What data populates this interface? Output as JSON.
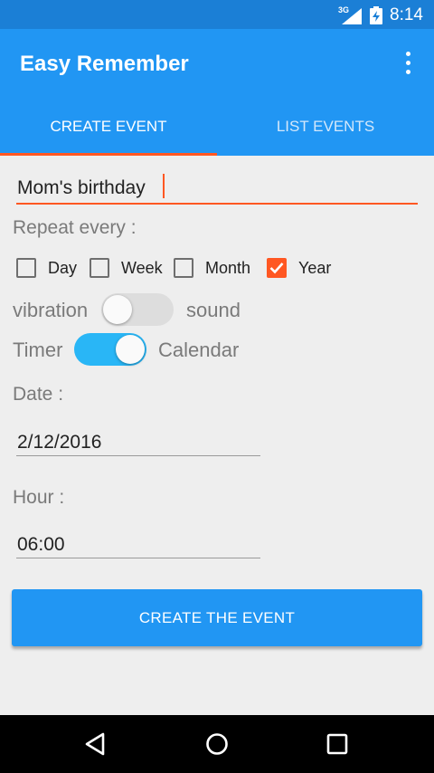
{
  "status_bar": {
    "time": "8:14",
    "network": "3G",
    "signal_icon": "signal-icon",
    "battery_icon": "battery-charging-icon"
  },
  "app_bar": {
    "title": "Easy Remember",
    "overflow_icon": "more-vertical-icon"
  },
  "tabs": [
    {
      "label": "CREATE EVENT",
      "active": true
    },
    {
      "label": "LIST EVENTS",
      "active": false
    }
  ],
  "form": {
    "event_name": "Mom's birthday",
    "repeat_label": "Repeat every :",
    "repeat_options": [
      {
        "label": "Day",
        "checked": false
      },
      {
        "label": "Week",
        "checked": false
      },
      {
        "label": "Month",
        "checked": false
      },
      {
        "label": "Year",
        "checked": true
      }
    ],
    "notify_switch": {
      "left_label": "vibration",
      "right_label": "sound",
      "on": false
    },
    "mode_switch": {
      "left_label": "Timer",
      "right_label": "Calendar",
      "on": true
    },
    "date_label": "Date :",
    "date_value": "2/12/2016",
    "hour_label": "Hour :",
    "hour_value": "06:00",
    "submit_label": "CREATE THE EVENT"
  },
  "nav_bar": {
    "back_icon": "back-triangle-icon",
    "home_icon": "home-circle-icon",
    "recents_icon": "recents-square-icon"
  },
  "colors": {
    "primary": "#2196f3",
    "status_bar": "#1b7fd6",
    "accent": "#ff5722",
    "switch_on": "#29b6f6",
    "background": "#eeeeee"
  }
}
